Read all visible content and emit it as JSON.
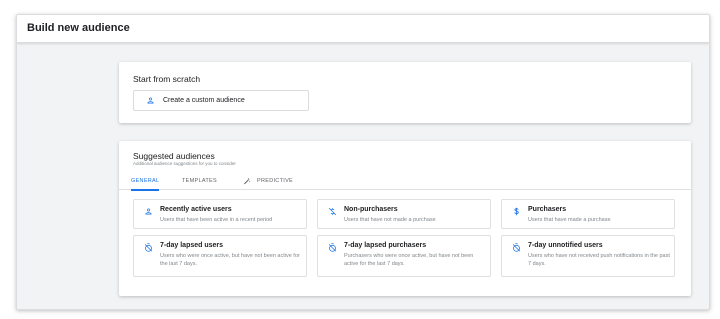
{
  "header": {
    "title": "Build new audience"
  },
  "scratch": {
    "title": "Start from scratch",
    "create_button": {
      "label": "Create a custom audience",
      "icon": "person-icon"
    }
  },
  "suggested": {
    "title": "Suggested audiences",
    "subtitle": "Additional audience suggestions for you to consider",
    "tabs": [
      {
        "label": "GENERAL",
        "active": true
      },
      {
        "label": "TEMPLATES",
        "active": false
      },
      {
        "label": "PREDICTIVE",
        "active": false,
        "icon": "sparkle-tools-icon"
      }
    ],
    "options": [
      {
        "title": "Recently active users",
        "description": "Users that have been active in a recent period",
        "icon": "person-icon"
      },
      {
        "title": "Non-purchasers",
        "description": "Users that have not made a purchase",
        "icon": "no-money-icon"
      },
      {
        "title": "Purchasers",
        "description": "Users that have made a purchase",
        "icon": "dollar-icon"
      },
      {
        "title": "7-day lapsed users",
        "description": "Users who were once active, but have not been active for the last 7 days.",
        "icon": "timer-off-icon"
      },
      {
        "title": "7-day lapsed purchasers",
        "description": "Purchasers who were once active, but have not been active for the last 7 days.",
        "icon": "timer-off-icon"
      },
      {
        "title": "7-day unnotified users",
        "description": "Users who have not received push notifications in the past 7 days.",
        "icon": "timer-off-icon"
      }
    ]
  },
  "colors": {
    "accent": "#1a73e8",
    "text": "#202124",
    "muted": "#80868b",
    "background": "#f1f3f4"
  }
}
